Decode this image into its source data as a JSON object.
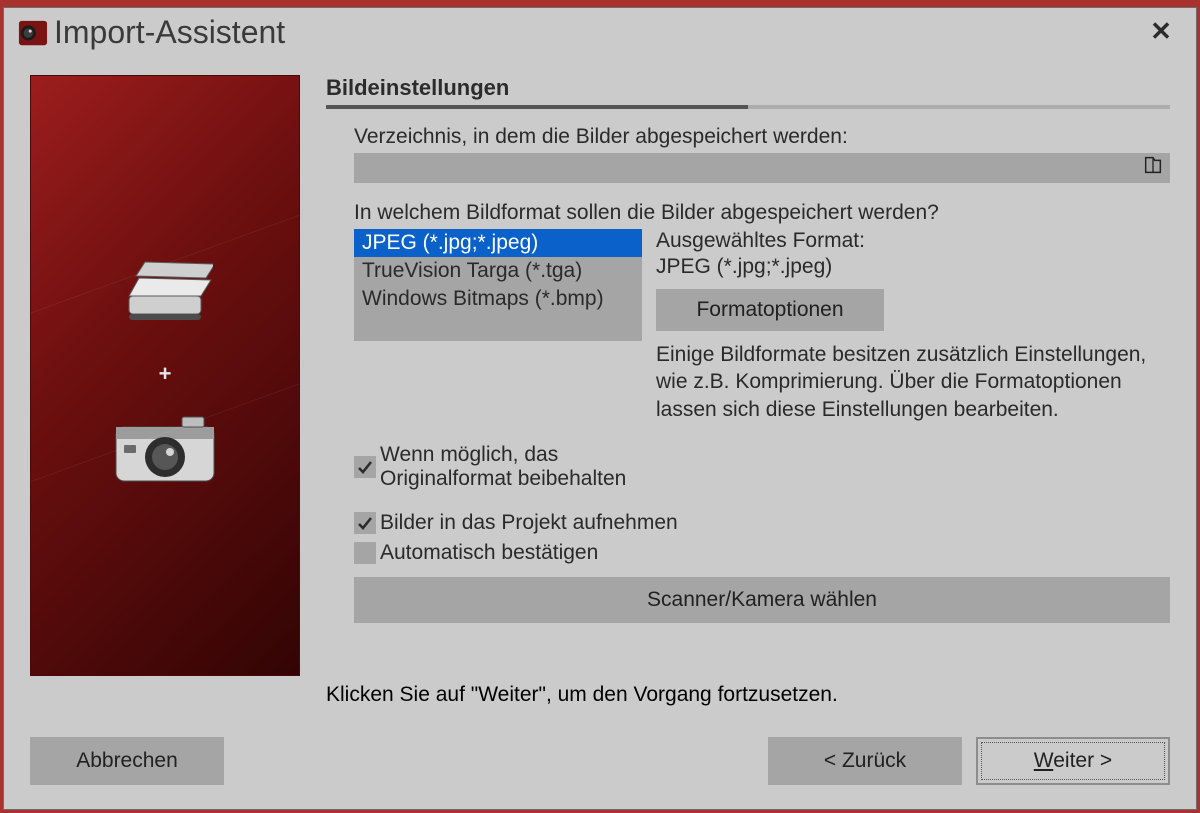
{
  "window": {
    "title": "Import-Assistent",
    "close_label": "✕"
  },
  "section_heading": "Bildeinstellungen",
  "directory": {
    "label": "Verzeichnis, in dem die Bilder abgespeichert werden:",
    "value": ""
  },
  "format_question": "In welchem Bildformat sollen die Bilder abgespeichert werden?",
  "format_list": {
    "items": [
      "JPEG (*.jpg;*.jpeg)",
      "TrueVision Targa (*.tga)",
      "Windows Bitmaps (*.bmp)"
    ],
    "selected_index": 0
  },
  "selected_format": {
    "label": "Ausgewähltes Format:",
    "value": "JPEG (*.jpg;*.jpeg)"
  },
  "buttons": {
    "format_options": "Formatoptionen",
    "scanner_camera": "Scanner/Kamera wählen",
    "cancel": "Abbrechen",
    "back": "< Zurück",
    "next_prefix": "W",
    "next_rest": "eiter >"
  },
  "format_hint": "Einige Bildformate besitzen zusätzlich Einstellungen, wie z.B. Komprimierung. Über die Formatoptionen lassen sich diese Einstellungen bearbeiten.",
  "checkboxes": {
    "keep_original": {
      "label": "Wenn möglich, das Originalformat beibehalten",
      "checked": true
    },
    "add_to_project": {
      "label": "Bilder in das Projekt aufnehmen",
      "checked": true
    },
    "auto_confirm": {
      "label": "Automatisch bestätigen",
      "checked": false
    }
  },
  "continue_hint": "Klicken Sie auf \"Weiter\", um den Vorgang fortzusetzen."
}
